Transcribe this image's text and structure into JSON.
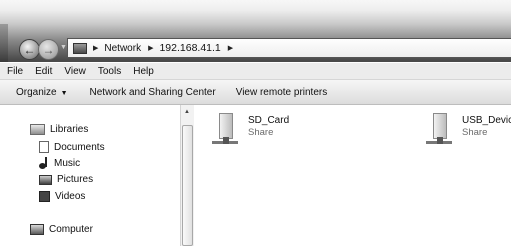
{
  "address_bar": {
    "crumbs": [
      "Network",
      "192.168.41.1"
    ]
  },
  "menubar": {
    "items": [
      "File",
      "Edit",
      "View",
      "Tools",
      "Help"
    ]
  },
  "toolbar": {
    "organize": "Organize",
    "network_sharing": "Network and Sharing Center",
    "view_printers": "View remote printers"
  },
  "nav_pane": {
    "libraries": "Libraries",
    "documents": "Documents",
    "music": "Music",
    "pictures": "Pictures",
    "videos": "Videos",
    "computer": "Computer"
  },
  "content": {
    "items": [
      {
        "name": "SD_Card",
        "type": "Share",
        "icon": "network-share-icon"
      },
      {
        "name": "USB_Device",
        "type": "Share",
        "icon": "network-share-icon"
      }
    ]
  }
}
